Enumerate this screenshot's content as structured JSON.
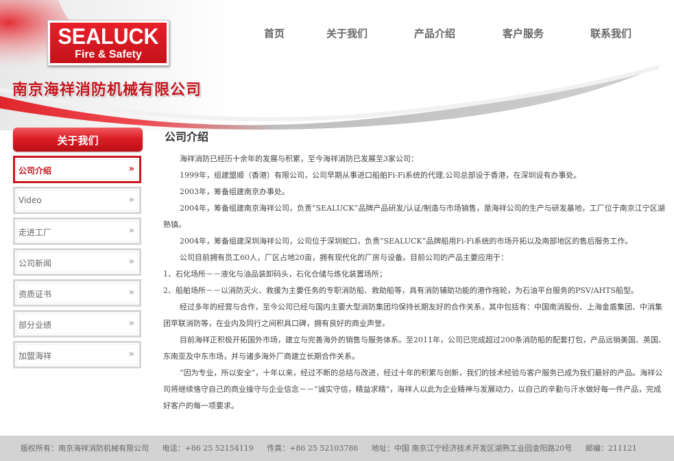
{
  "brand": {
    "logo_name": "SEALUCK",
    "logo_sub": "Fire & Safety",
    "company_name": "南京海祥消防机械有限公司"
  },
  "nav": {
    "items": [
      "首页",
      "关于我们",
      "产品介绍",
      "客户服务",
      "联系我们"
    ]
  },
  "sidebar": {
    "title": "关于我们",
    "arrow": "»",
    "items": [
      {
        "label": "公司介绍",
        "active": true
      },
      {
        "label": "Video"
      },
      {
        "label": "走进工厂"
      },
      {
        "label": "公司新闻"
      },
      {
        "label": "资质证书"
      },
      {
        "label": "部分业绩"
      },
      {
        "label": "加盟海祥"
      }
    ]
  },
  "content": {
    "title": "公司介绍",
    "paragraphs": [
      "海祥消防已经历十余年的发展与积累，至今海祥消防已发展至3家公司：",
      "1999年，组建盟顺（香港）有限公司，公司早期从事进口船舶Fi-Fi系统的代理,公司总部设于香港，在深圳设有办事处。",
      "2003年，筹备组建南京办事处。",
      "2004年，筹备组建南京海祥公司，负责“SEALUCK”品牌产品研发/认证/制造与市场销售，是海祥公司的生产与研发基地，工厂位于南京江宁区湖熟镇。",
      "2004年，筹备组建深圳海祥公司，公司位于深圳蛇口，负责“SEALUCK”品牌船用Fi-Fi系统的市场开拓以及南部地区的售后服务工作。",
      "公司目前拥有员工60人，厂区占地20亩，拥有现代化的厂房与设备。目前公司的产品主要应用于：",
      "1、石化场所－－液化与油品装卸码头，石化仓储与炼化装置场所；",
      "2、船舶场所－－以消防灭火、救援为主要任务的专职消防船、救助船等，具有消防辅助功能的港作拖轮，为石油平台服务的PSV/AHTS船型。",
      "经过多年的经营与合作，至今公司已经与国内主要大型消防集团均保持长期友好的合作关系，其中包括有：中国南消股份、上海金盾集团、中消集团苹联消防等，在业内及同行之间积具口碑，拥有良好的商业声誉。",
      "目前海祥正积极开拓国外市场，建立与完善海外的销售与服务体系。至2011年，公司已完成超过200条消防船的配套打包，产品远销美国、英国、东南亚及中东市场，并与诸多海外厂商建立长期合作关系。",
      "“因为专业，所以安全”，十年以来，经过不断的总结与改进，经过十年的积累与创新，我们的技术经验与客户服务已成为我们最好的产品。海祥公司将继续恪守自己的商业操守与企业信念－－“诚实守信，精益求精”，海祥人以此为企业精神与发展动力，以自己的辛勤与汗水做好每一件产品，完成好客户的每一项要求。"
    ]
  },
  "footer": {
    "copyright": "版权所有：南京海祥消防机械有限公司",
    "phone": "电话：+86 25 52154119",
    "fax": "传真：+86 25 52103786",
    "address": "地址：中国 南京江宁经济技术开发区湖熟工业园金阳路20号",
    "postcode": "邮编：211121"
  },
  "colors": {
    "brand_red": "#c8161e",
    "nav_gray": "#666666",
    "footer_bg": "#d3d3d3"
  }
}
